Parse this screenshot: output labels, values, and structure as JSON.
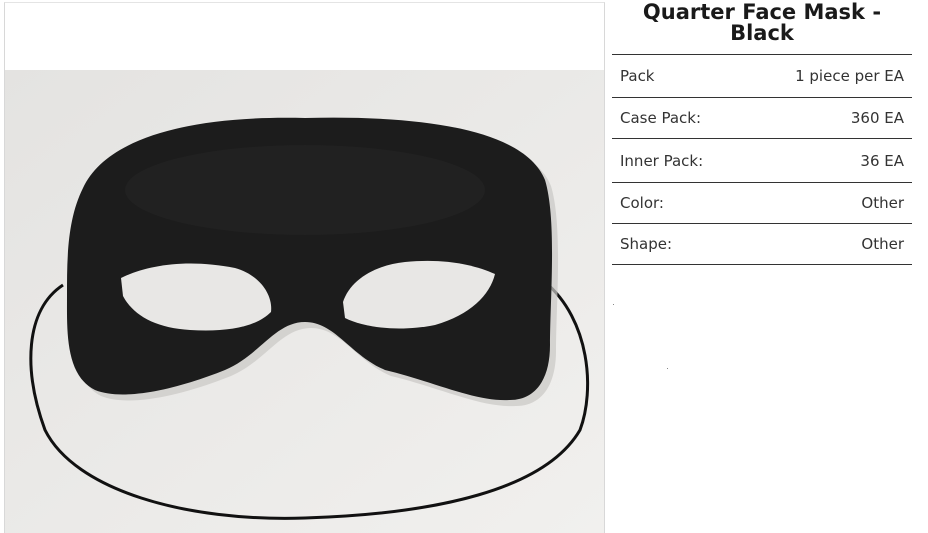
{
  "product": {
    "title": "Quarter Face Mask - Black",
    "image_alt": "Black quarter face mask with elastic band"
  },
  "specs": [
    {
      "label": "Pack",
      "value": "1 piece per EA"
    },
    {
      "label": "Case Pack:",
      "value": "360 EA"
    },
    {
      "label": "Inner Pack:",
      "value": "36 EA"
    },
    {
      "label": "Color:",
      "value": "Other"
    },
    {
      "label": "Shape:",
      "value": "Other"
    }
  ],
  "colors": {
    "mask": "#1c1c1c",
    "photo_background": "#e9e8e6",
    "table_rule": "#333333"
  }
}
